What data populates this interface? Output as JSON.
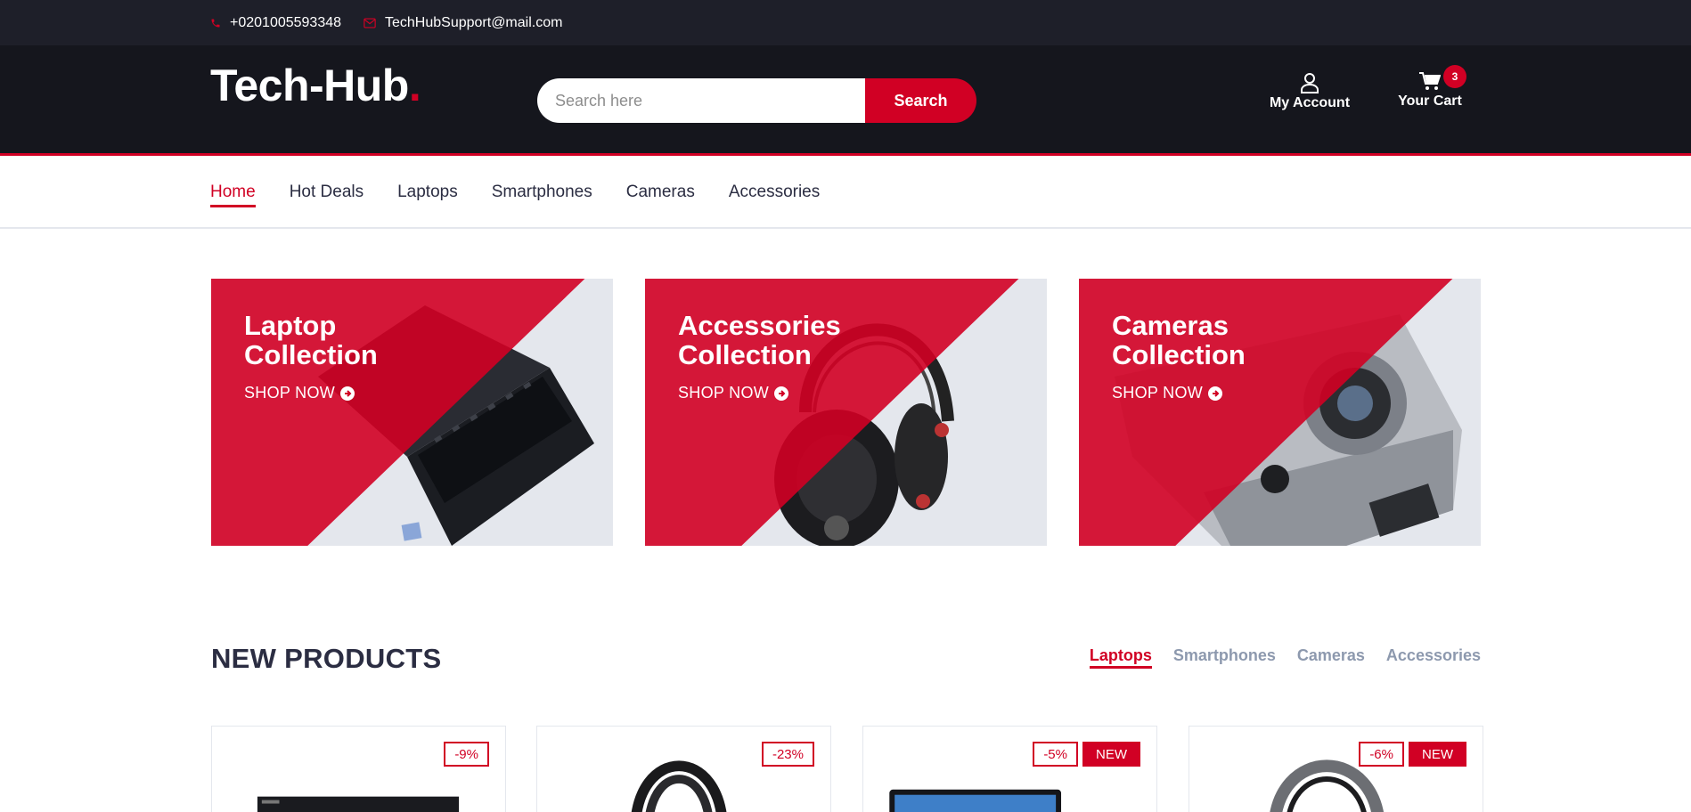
{
  "topbar": {
    "phone": "+0201005593348",
    "email": "TechHubSupport@mail.com",
    "icon_phone": "phone-icon",
    "icon_email": "envelope-icon"
  },
  "header": {
    "logo_text": "Tech-Hub",
    "logo_dot": ".",
    "search_placeholder": "Search here",
    "search_button": "Search",
    "account_label": "My Account",
    "cart_label": "Your Cart",
    "cart_count": "3"
  },
  "nav": {
    "items": [
      "Home",
      "Hot Deals",
      "Laptops",
      "Smartphones",
      "Cameras",
      "Accessories"
    ],
    "active": "Home"
  },
  "collections": [
    {
      "title_line1": "Laptop",
      "title_line2": "Collection",
      "cta": "SHOP NOW",
      "icon": "laptop-image"
    },
    {
      "title_line1": "Accessories",
      "title_line2": "Collection",
      "cta": "SHOP NOW",
      "icon": "headphones-image"
    },
    {
      "title_line1": "Cameras",
      "title_line2": "Collection",
      "cta": "SHOP NOW",
      "icon": "camera-image"
    }
  ],
  "new_products": {
    "title": "NEW PRODUCTS",
    "tabs": [
      "Laptops",
      "Smartphones",
      "Cameras",
      "Accessories"
    ],
    "active_tab": "Laptops",
    "cards": [
      {
        "sale": "-9%",
        "new": ""
      },
      {
        "sale": "-23%",
        "new": ""
      },
      {
        "sale": "-5%",
        "new": "NEW"
      },
      {
        "sale": "-6%",
        "new": "NEW"
      }
    ]
  },
  "colors": {
    "accent": "#d10024",
    "topbar_bg": "#1e1f29",
    "header_bg": "#15161d",
    "tab_inactive": "#8d99ae"
  }
}
